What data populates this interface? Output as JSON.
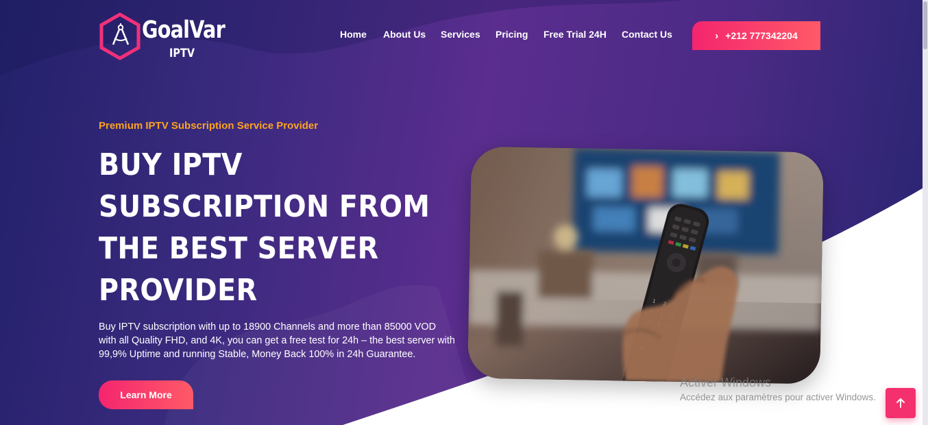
{
  "brand": {
    "name": "GoalVar",
    "sub": "IPTV"
  },
  "nav": {
    "items": [
      {
        "label": "Home"
      },
      {
        "label": "About Us"
      },
      {
        "label": "Services"
      },
      {
        "label": "Pricing"
      },
      {
        "label": "Free Trial 24H"
      },
      {
        "label": "Contact Us"
      }
    ],
    "cta_label": "+212 777342204"
  },
  "hero": {
    "eyebrow": "Premium IPTV Subscription Service Provider",
    "headline_lines": [
      "BUY IPTV",
      "SUBSCRIPTION FROM",
      "THE BEST SERVER",
      "PROVIDER"
    ],
    "description": "Buy IPTV subscription with up to 18900 Channels and more than 85000 VOD with all Quality FHD, and 4K, you can get a free test for 24h – the best server with 99,9% Uptime and running Stable, Money Back 100% in 24h Guarantee.",
    "button_label": "Learn More"
  },
  "watermark": {
    "title": "Activer Windows",
    "subtitle": "Accédez aux paramètres pour activer Windows."
  },
  "colors": {
    "accent": "#f4256e",
    "accent_end": "#ff5a68",
    "eyebrow": "#ffa322",
    "background_dark": "#23216a",
    "background_mid": "#5a2d8e"
  },
  "icons": {
    "logo": "compass-hexagon-icon",
    "cta": "chevron-right-icon",
    "back_to_top": "arrow-up-icon"
  }
}
